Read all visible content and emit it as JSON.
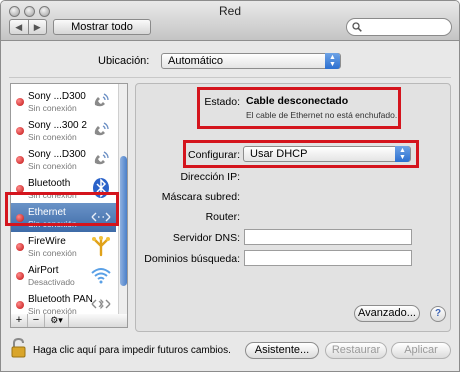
{
  "window": {
    "title": "Red"
  },
  "toolbar": {
    "back_glyph": "◀",
    "forward_glyph": "▶",
    "show_all_label": "Mostrar todo",
    "search_placeholder": ""
  },
  "location": {
    "label": "Ubicación:",
    "value": "Automático"
  },
  "sidebar": {
    "items": [
      {
        "name": "Sony ...D300",
        "status": "Sin conexión",
        "icon": "phone-icon"
      },
      {
        "name": "Sony ...300 2",
        "status": "Sin conexión",
        "icon": "phone-icon"
      },
      {
        "name": "Sony ...D300",
        "status": "Sin conexión",
        "icon": "phone-icon"
      },
      {
        "name": "Bluetooth",
        "status": "Sin conexión",
        "icon": "bluetooth-icon"
      },
      {
        "name": "Ethernet",
        "status": "Sin conexión",
        "icon": "ethernet-icon",
        "selected": true
      },
      {
        "name": "FireWire",
        "status": "Sin conexión",
        "icon": "firewire-icon"
      },
      {
        "name": "AirPort",
        "status": "Desactivado",
        "icon": "wifi-icon"
      },
      {
        "name": "Bluetooth PAN",
        "status": "Sin conexión",
        "icon": "bluetooth-pan-icon"
      }
    ],
    "add_label": "+",
    "remove_label": "−",
    "gear_label": "⚙▾"
  },
  "details": {
    "status_label": "Estado:",
    "status_value": "Cable desconectado",
    "status_detail": "El cable de Ethernet no está enchufado.",
    "configure_label": "Configurar:",
    "configure_value": "Usar DHCP",
    "ip_label": "Dirección IP:",
    "mask_label": "Máscara subred:",
    "router_label": "Router:",
    "dns_label": "Servidor DNS:",
    "dns_value": "",
    "search_domains_label": "Dominios búsqueda:",
    "search_domains_value": "",
    "advanced_label": "Avanzado...",
    "help_label": "?"
  },
  "footer": {
    "lock_text": "Haga clic aquí para impedir futuros cambios.",
    "assistant_label": "Asistente...",
    "revert_label": "Restaurar",
    "apply_label": "Aplicar"
  },
  "colors": {
    "highlight": "#d4141d",
    "selection": "#4a77b4",
    "status_red": "#c01010"
  }
}
